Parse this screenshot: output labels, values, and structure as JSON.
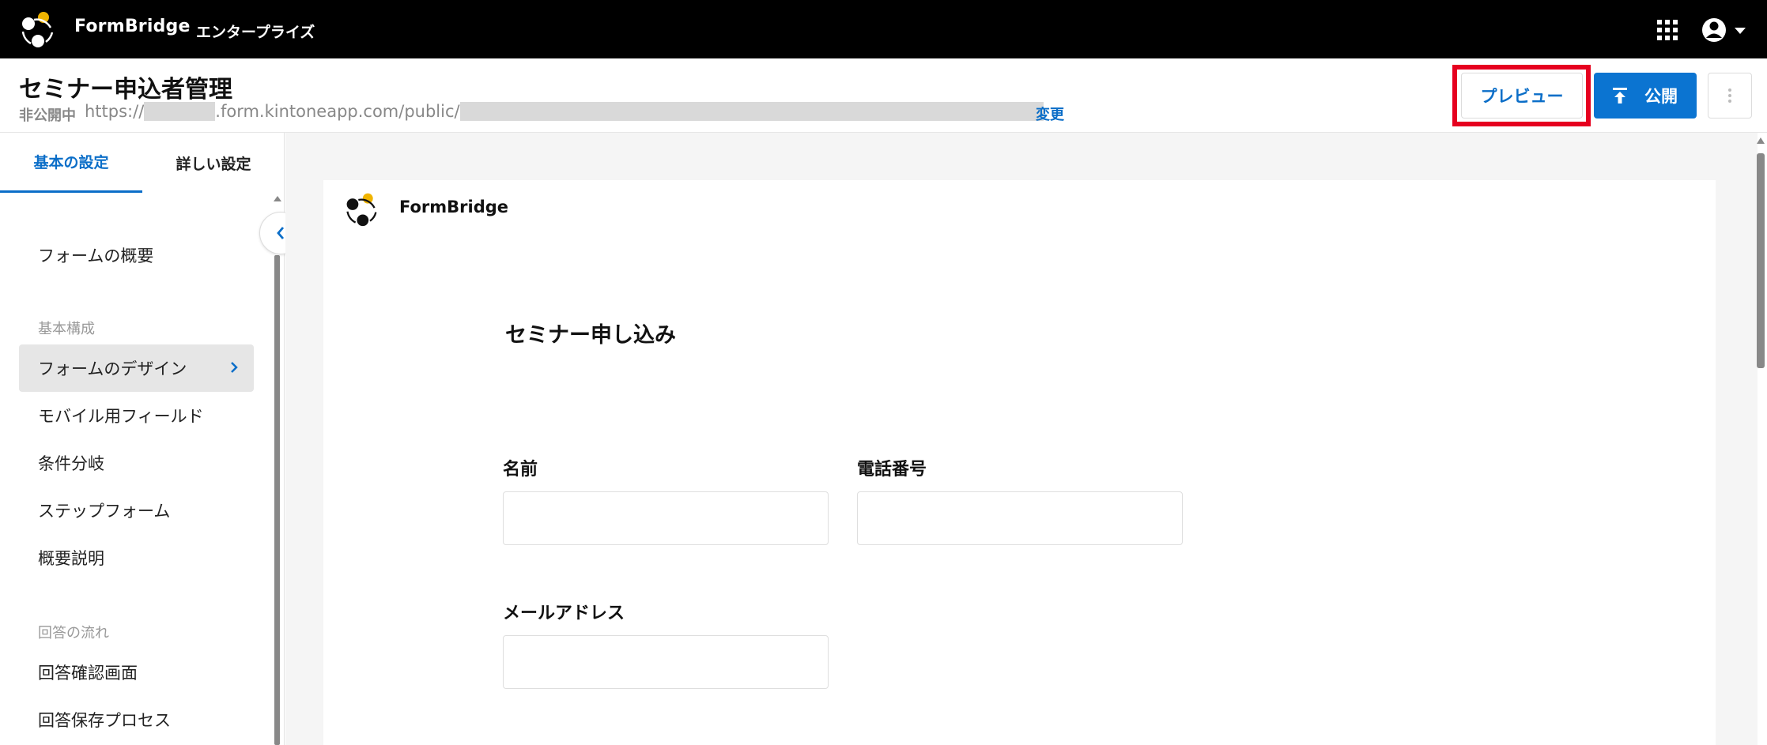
{
  "app": {
    "brand": "FormBridge",
    "edition": "エンタープライズ"
  },
  "header": {
    "title": "セミナー申込者管理",
    "status": "非公開中",
    "url_prefix": "https://",
    "url_mid": ".form.kintoneapp.com/public/",
    "change_link": "変更",
    "preview_label": "プレビュー",
    "publish_label": "公開"
  },
  "sidebar": {
    "tabs": [
      {
        "label": "基本の設定",
        "active": true
      },
      {
        "label": "詳しい設定",
        "active": false
      }
    ],
    "overview": "フォームの概要",
    "section_basic": "基本構成",
    "items_basic": [
      {
        "label": "フォームのデザイン",
        "active": true
      },
      {
        "label": "モバイル用フィールド"
      },
      {
        "label": "条件分岐"
      },
      {
        "label": "ステップフォーム"
      },
      {
        "label": "概要説明"
      }
    ],
    "section_flow": "回答の流れ",
    "items_flow": [
      {
        "label": "回答確認画面"
      },
      {
        "label": "回答保存プロセス"
      }
    ]
  },
  "form": {
    "brand": "FormBridge",
    "title": "セミナー申し込み",
    "fields": [
      {
        "label": "名前",
        "value": ""
      },
      {
        "label": "電話番号",
        "value": ""
      },
      {
        "label": "メールアドレス",
        "value": ""
      }
    ]
  },
  "colors": {
    "accent": "#0b6ec8",
    "publish": "#0b74d1",
    "highlight": "#e6001f",
    "logo_yellow": "#f0b400"
  },
  "icons": [
    "formbridge-logo",
    "apps-grid-icon",
    "user-avatar-icon",
    "caret-down-icon",
    "upload-icon",
    "more-vert-icon",
    "chevron-right-icon",
    "chevron-left-icon"
  ]
}
